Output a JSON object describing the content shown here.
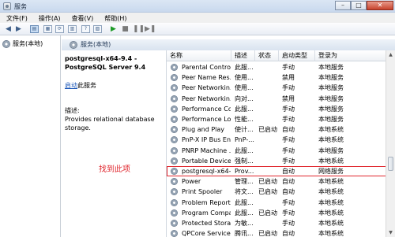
{
  "window": {
    "title": "服务",
    "minimize": "–",
    "maximize": "□",
    "close": "✕"
  },
  "menu": [
    "文件(F)",
    "操作(A)",
    "查看(V)",
    "帮助(H)"
  ],
  "tree": {
    "root_label": "服务(本地)"
  },
  "band": {
    "title": "服务(本地)"
  },
  "selected_service": {
    "name": "postgresql-x64-9.4 - PostgreSQL Server 9.4",
    "start_link": "启动",
    "start_suffix": "此服务",
    "desc_label": "描述:",
    "desc_text": "Provides relational database storage."
  },
  "annotation": "找到此项",
  "columns": [
    "名称",
    "描述",
    "状态",
    "启动类型",
    "登录为"
  ],
  "rows": [
    {
      "name": "Parental Controls",
      "desc": "此服...",
      "status": "",
      "startup": "手动",
      "logon": "本地服务"
    },
    {
      "name": "Peer Name Res...",
      "desc": "使用...",
      "status": "",
      "startup": "禁用",
      "logon": "本地服务"
    },
    {
      "name": "Peer Networkin...",
      "desc": "使用...",
      "status": "",
      "startup": "手动",
      "logon": "本地服务"
    },
    {
      "name": "Peer Networkin...",
      "desc": "向对...",
      "status": "",
      "startup": "禁用",
      "logon": "本地服务"
    },
    {
      "name": "Performance Co...",
      "desc": "此服...",
      "status": "",
      "startup": "手动",
      "logon": "本地服务"
    },
    {
      "name": "Performance Lo...",
      "desc": "性能...",
      "status": "",
      "startup": "手动",
      "logon": "本地服务"
    },
    {
      "name": "Plug and Play",
      "desc": "使计...",
      "status": "已启动",
      "startup": "自动",
      "logon": "本地系统"
    },
    {
      "name": "PnP-X IP Bus En...",
      "desc": "PnP-...",
      "status": "",
      "startup": "手动",
      "logon": "本地系统"
    },
    {
      "name": "PNRP Machine ...",
      "desc": "此服...",
      "status": "",
      "startup": "手动",
      "logon": "本地服务"
    },
    {
      "name": "Portable Device ...",
      "desc": "强制...",
      "status": "",
      "startup": "手动",
      "logon": "本地系统"
    },
    {
      "name": "postgresql-x64-...",
      "desc": "Prov...",
      "status": "",
      "startup": "自动",
      "logon": "网络服务"
    },
    {
      "name": "Power",
      "desc": "管理...",
      "status": "已启动",
      "startup": "自动",
      "logon": "本地系统"
    },
    {
      "name": "Print Spooler",
      "desc": "将文...",
      "status": "已启动",
      "startup": "自动",
      "logon": "本地系统"
    },
    {
      "name": "Problem Report...",
      "desc": "此服...",
      "status": "",
      "startup": "手动",
      "logon": "本地系统"
    },
    {
      "name": "Program Compa...",
      "desc": "此服...",
      "status": "已启动",
      "startup": "手动",
      "logon": "本地系统"
    },
    {
      "name": "Protected Storage",
      "desc": "为敏...",
      "status": "",
      "startup": "手动",
      "logon": "本地系统"
    },
    {
      "name": "QPCore Service",
      "desc": "腾讯...",
      "status": "已启动",
      "startup": "自动",
      "logon": "本地系统"
    }
  ],
  "highlighted_row_index": 10
}
